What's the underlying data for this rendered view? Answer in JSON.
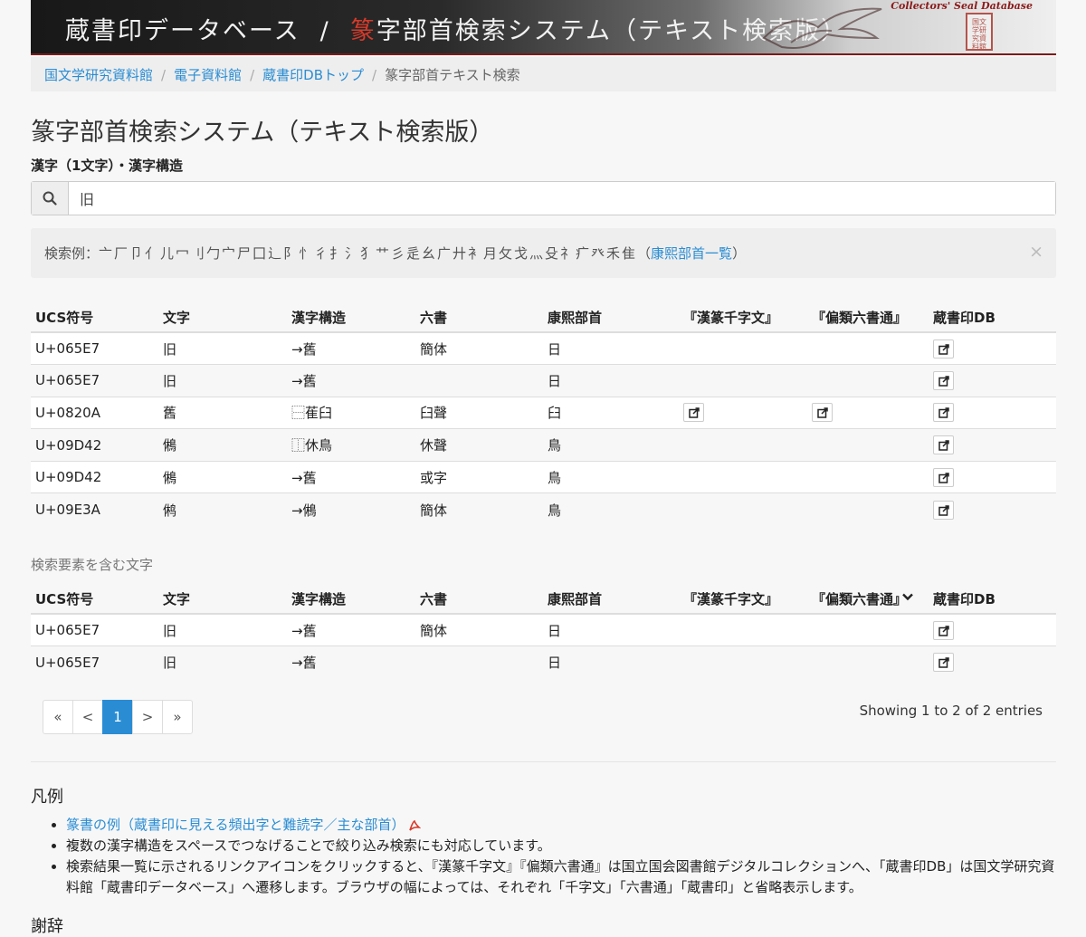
{
  "banner": {
    "title_left": "蔵書印データベース",
    "separator": "/",
    "title_red": "篆",
    "title_right": "字部首検索システム（テキスト検索版）",
    "english": "Collectors' Seal Database",
    "seal_text": "国文学研究資料館"
  },
  "breadcrumb": {
    "items": [
      "国文学研究資料館",
      "電子資料館",
      "蔵書印DBトップ"
    ],
    "separator": "/",
    "current": "篆字部首テキスト検索"
  },
  "page_title": "篆字部首検索システム（テキスト検索版）",
  "field_label": "漢字（1文字）・漢字構造",
  "search": {
    "value": "旧",
    "icon": "search-icon"
  },
  "examples": {
    "prefix": "検索例：",
    "chars": "亠厂卩亻儿冖刂勹宀尸囗辶阝忄彳扌氵犭艹彡辵幺广廾衤月攵戈灬殳礻疒癶禾隹",
    "link_open": "（",
    "link": "康熙部首一覧",
    "link_close": "）",
    "close": "×"
  },
  "columns": [
    "UCS符号",
    "文字",
    "漢字構造",
    "六書",
    "康熙部首",
    "『漢篆千字文』",
    "『偏類六書通』",
    "蔵書印DB"
  ],
  "results": [
    {
      "ucs": "U+065E7",
      "char": "旧",
      "structure": "→舊",
      "liushu": "簡体",
      "radical": "日",
      "qianziwen": false,
      "liushutong": false,
      "db": true
    },
    {
      "ucs": "U+065E7",
      "char": "旧",
      "structure": "→舊",
      "liushu": "",
      "radical": "日",
      "qianziwen": false,
      "liushutong": false,
      "db": true
    },
    {
      "ucs": "U+0820A",
      "char": "舊",
      "structure": "⿱萑臼",
      "liushu": "臼聲",
      "radical": "臼",
      "qianziwen": true,
      "liushutong": true,
      "db": true
    },
    {
      "ucs": "U+09D42",
      "char": "鵂",
      "structure": "⿰休鳥",
      "liushu": "休聲",
      "radical": "鳥",
      "qianziwen": false,
      "liushutong": false,
      "db": true
    },
    {
      "ucs": "U+09D42",
      "char": "鵂",
      "structure": "→舊",
      "liushu": "或字",
      "radical": "鳥",
      "qianziwen": false,
      "liushutong": false,
      "db": true
    },
    {
      "ucs": "U+09E3A",
      "char": "鸺",
      "structure": "→鵂",
      "liushu": "簡体",
      "radical": "鳥",
      "qianziwen": false,
      "liushutong": false,
      "db": true
    }
  ],
  "section_caption": "検索要素を含む文字",
  "sub_results": [
    {
      "ucs": "U+065E7",
      "char": "旧",
      "structure": "→舊",
      "liushu": "簡体",
      "radical": "日",
      "db": true
    },
    {
      "ucs": "U+065E7",
      "char": "旧",
      "structure": "→舊",
      "liushu": "",
      "radical": "日",
      "db": true
    }
  ],
  "pagination": {
    "first": "«",
    "prev": "<",
    "current": "1",
    "next": ">",
    "last": "»"
  },
  "showing": "Showing 1 to 2 of 2 entries",
  "legend": {
    "title": "凡例",
    "item1_link": "篆書の例（蔵書印に見える頻出字と難読字／主な部首）",
    "item2": "複数の漢字構造をスペースでつなげることで絞り込み検索にも対応しています。",
    "item3": "検索結果一覧に示されるリンクアイコンをクリックすると、『漢篆千字文』『偏類六書通』は国立国会図書館デジタルコレクションへ、「蔵書印DB」は国文学研究資料館「蔵書印データベース」へ遷移します。ブラウザの幅によっては、それぞれ「千字文」「六書通」「蔵書印」と省略表示します。"
  },
  "thanks_title": "謝辞",
  "colors": {
    "link": "#2a8dd4",
    "active_page": "#2a8dd4",
    "banner_red": "#d83a2a"
  }
}
